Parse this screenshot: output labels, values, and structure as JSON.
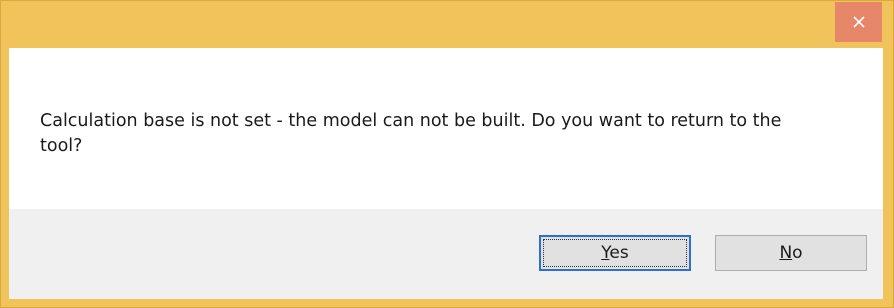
{
  "dialog": {
    "title": "",
    "message": "Calculation base is not set - the model can not be built. Do you want to return to the tool?",
    "buttons": {
      "yes": {
        "mnemonic": "Y",
        "rest": "es"
      },
      "no": {
        "mnemonic": "N",
        "rest": "o"
      }
    },
    "colors": {
      "frame": "#f0c45a",
      "close_button": "#e7876a",
      "focus_border": "#2b6fcf"
    },
    "icons": {
      "close": "close-icon"
    }
  }
}
